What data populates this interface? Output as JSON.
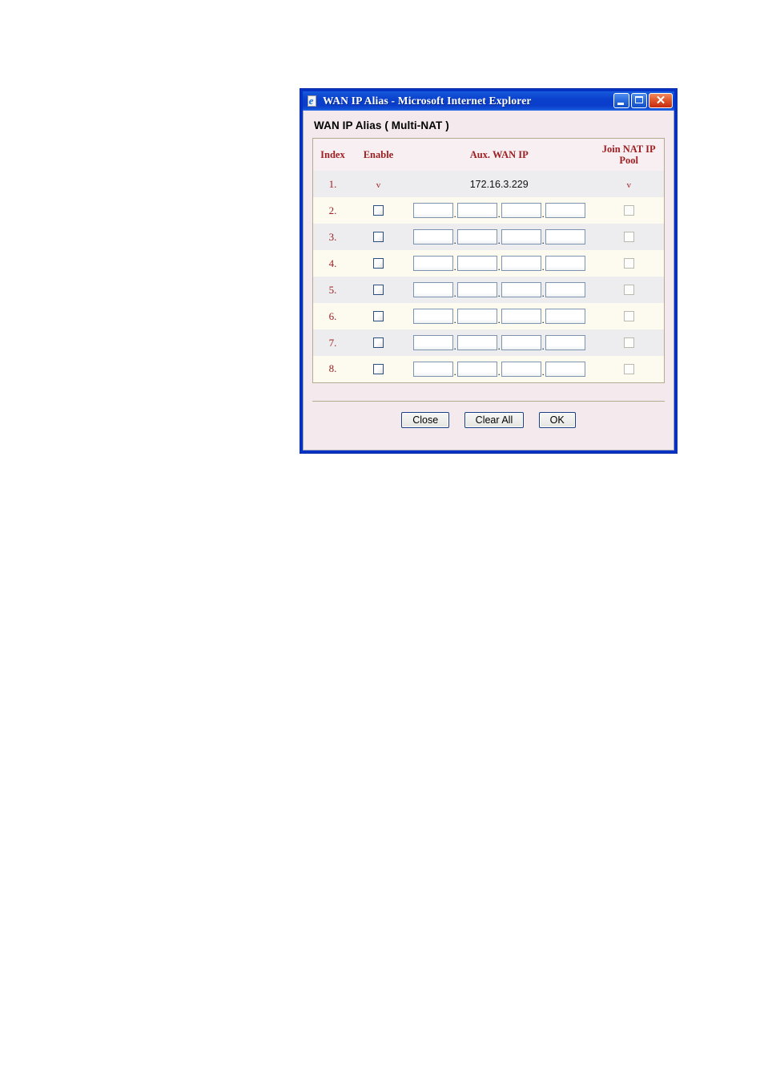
{
  "window": {
    "title": "WAN IP Alias - Microsoft Internet Explorer",
    "icon": "internet-explorer-icon",
    "controls": {
      "minimize": "minimize-icon",
      "maximize": "maximize-icon",
      "close": "close-icon",
      "close_glyph": "✕"
    },
    "title_bar_color": "#0b41cd",
    "border_color": "#0531c4"
  },
  "page": {
    "title": "WAN IP Alias ( Multi-NAT )",
    "background_color": "#f4e9ec",
    "accent_color": "#9e1f22"
  },
  "table": {
    "headers": {
      "index": "Index",
      "enable": "Enable",
      "aux_wan_ip": "Aux. WAN IP",
      "join_nat_ip_pool": "Join NAT IP Pool"
    },
    "header_bg": "#f7eff1",
    "row_bg_odd": "#ededef",
    "row_bg_even": "#fdfaef",
    "border_color": "#b3ab8f",
    "check_mark": "v",
    "octet_separator": ".",
    "rows": [
      {
        "index": "1.",
        "readonly": true,
        "enable_mark": "v",
        "ip": "172.16.3.229",
        "pool_mark": "v"
      },
      {
        "index": "2.",
        "readonly": false,
        "enable_checked": false,
        "octets": [
          "",
          "",
          "",
          ""
        ],
        "pool_checked": false,
        "pool_disabled": true
      },
      {
        "index": "3.",
        "readonly": false,
        "enable_checked": false,
        "octets": [
          "",
          "",
          "",
          ""
        ],
        "pool_checked": false,
        "pool_disabled": true
      },
      {
        "index": "4.",
        "readonly": false,
        "enable_checked": false,
        "octets": [
          "",
          "",
          "",
          ""
        ],
        "pool_checked": false,
        "pool_disabled": true
      },
      {
        "index": "5.",
        "readonly": false,
        "enable_checked": false,
        "octets": [
          "",
          "",
          "",
          ""
        ],
        "pool_checked": false,
        "pool_disabled": true
      },
      {
        "index": "6.",
        "readonly": false,
        "enable_checked": false,
        "octets": [
          "",
          "",
          "",
          ""
        ],
        "pool_checked": false,
        "pool_disabled": true
      },
      {
        "index": "7.",
        "readonly": false,
        "enable_checked": false,
        "octets": [
          "",
          "",
          "",
          ""
        ],
        "pool_checked": false,
        "pool_disabled": true
      },
      {
        "index": "8.",
        "readonly": false,
        "enable_checked": false,
        "octets": [
          "",
          "",
          "",
          ""
        ],
        "pool_checked": false,
        "pool_disabled": true
      }
    ]
  },
  "footer": {
    "close_label": "Close",
    "clear_all_label": "Clear All",
    "ok_label": "OK"
  }
}
